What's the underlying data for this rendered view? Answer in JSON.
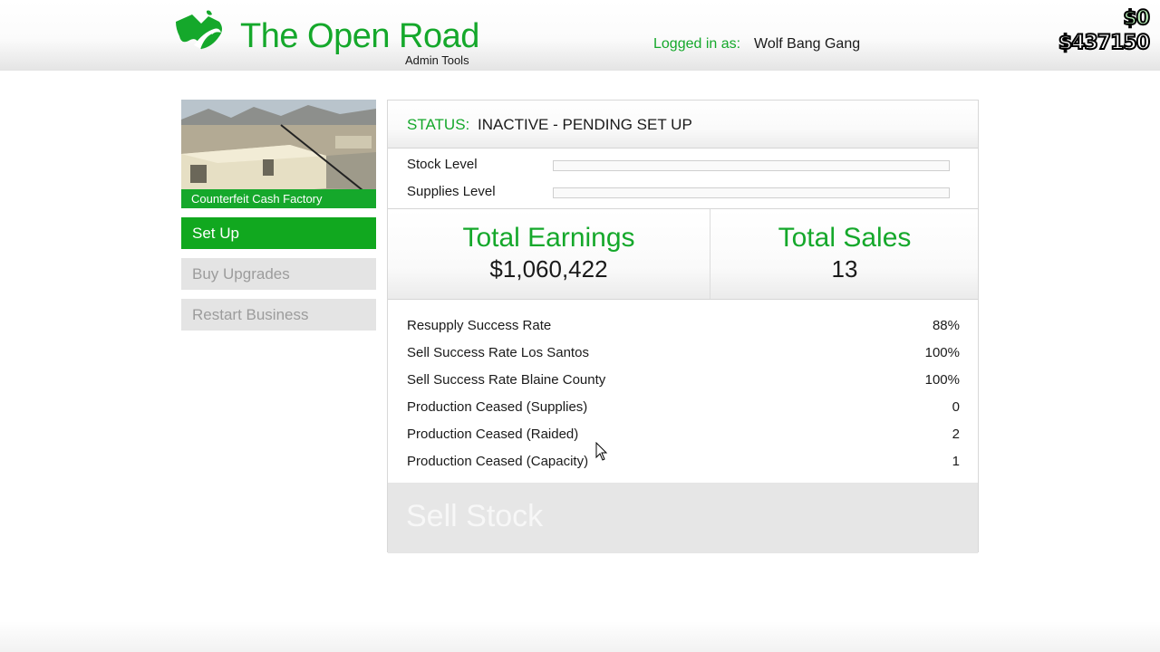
{
  "header": {
    "brand_title": "The Open Road",
    "brand_subtitle": "Admin Tools",
    "login_label": "Logged in as:",
    "username": "Wolf Bang Gang",
    "wallet_cash": "$0",
    "bank_cash": "$437150"
  },
  "sidebar": {
    "business_name": "Counterfeit Cash Factory",
    "buttons": [
      {
        "label": "Set Up",
        "state": "active"
      },
      {
        "label": "Buy Upgrades",
        "state": "disabled"
      },
      {
        "label": "Restart Business",
        "state": "disabled"
      }
    ]
  },
  "main": {
    "status_label": "STATUS:",
    "status_value": "INACTIVE - PENDING SET UP",
    "levels": [
      {
        "label": "Stock Level",
        "fill_percent": 0
      },
      {
        "label": "Supplies Level",
        "fill_percent": 0
      }
    ],
    "total_earnings_label": "Total Earnings",
    "total_earnings_value": "$1,060,422",
    "total_sales_label": "Total Sales",
    "total_sales_value": "13",
    "stats": [
      {
        "label": "Resupply Success Rate",
        "value": "88%"
      },
      {
        "label": "Sell Success Rate Los Santos",
        "value": "100%"
      },
      {
        "label": "Sell Success Rate Blaine County",
        "value": "100%"
      },
      {
        "label": "Production Ceased (Supplies)",
        "value": "0"
      },
      {
        "label": "Production Ceased (Raided)",
        "value": "2"
      },
      {
        "label": "Production Ceased (Capacity)",
        "value": "1"
      }
    ],
    "sell_button_label": "Sell Stock"
  },
  "colors": {
    "accent_green": "#15a82b",
    "active_button": "#11a81f",
    "disabled_button": "#e4e4e4"
  },
  "icons": {
    "logo": "open-road-mountain-logo",
    "cursor": "mouse-pointer"
  }
}
